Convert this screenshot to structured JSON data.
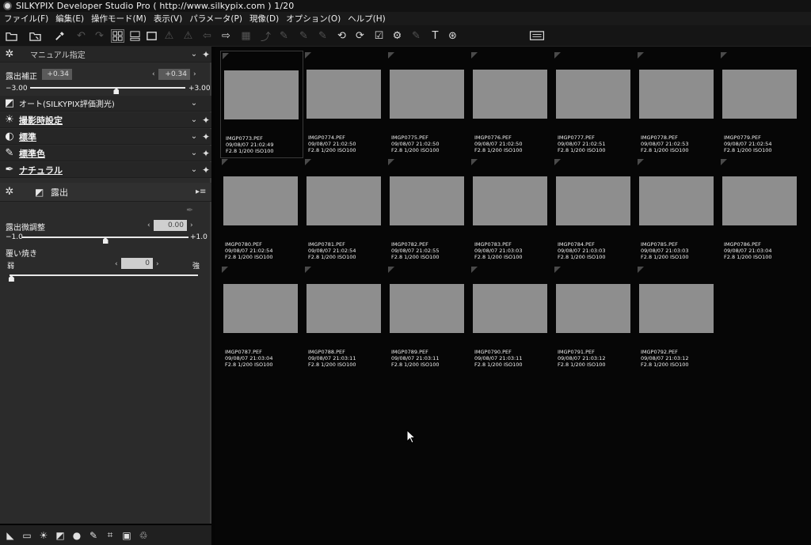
{
  "window": {
    "title": "SILKYPIX Developer Studio Pro ( http://www.silkypix.com ) 1/20"
  },
  "menu": [
    "ファイル(F)",
    "編集(E)",
    "操作モード(M)",
    "表示(V)",
    "パラメータ(P)",
    "現像(D)",
    "オプション(O)",
    "ヘルプ(H)"
  ],
  "toolbar": {
    "icons": [
      "open-folder-icon",
      "browse-folder-icon",
      "eyedropper-icon",
      "undo-icon",
      "redo-icon",
      "grid-view-icon",
      "filmstrip-view-icon",
      "single-view-icon",
      "warning-icon",
      "warning-icon-2",
      "back-icon",
      "forward-icon",
      "crop-icon",
      "rotate-left-icon",
      "rotate-right-icon",
      "checkbox-icon",
      "mark-icon",
      "pen-icon",
      "hammer-icon",
      "settings-icon",
      "monitor-icon"
    ]
  },
  "panel": {
    "mode_label": "マニュアル指定",
    "exposure_comp": {
      "label": "露出補正",
      "value": "+0.34",
      "value2": "+0.34",
      "min": "−3.00",
      "max": "+3.00",
      "level": 0.556
    },
    "auto_label": "オート(SILKYPIX評価測光)",
    "rows": [
      {
        "icon": "sun-icon",
        "label": "撮影時設定"
      },
      {
        "icon": "contrast-icon",
        "label": "標準"
      },
      {
        "icon": "color-icon",
        "label": "標準色"
      },
      {
        "icon": "palette-icon",
        "label": "ナチュラル"
      }
    ],
    "section_title": "露出",
    "fine_tune": {
      "label": "露出微調整",
      "value": "0.00",
      "min": "−1.0",
      "max": "+1.0",
      "level": 0.5
    },
    "dodge": {
      "label": "覆い焼き",
      "value": "0",
      "min": "弱",
      "max": "強",
      "level": 0.0
    }
  },
  "thumbnails": [
    {
      "file": "IMGP0773.PEF",
      "date": "09/08/07 21:02:49",
      "info": "F2.8 1/200 ISO100"
    },
    {
      "file": "IMGP0774.PEF",
      "date": "09/08/07 21:02:50",
      "info": "F2.8 1/200 ISO100"
    },
    {
      "file": "IMGP0775.PEF",
      "date": "09/08/07 21:02:50",
      "info": "F2.8 1/200 ISO100"
    },
    {
      "file": "IMGP0776.PEF",
      "date": "09/08/07 21:02:50",
      "info": "F2.8 1/200 ISO100"
    },
    {
      "file": "IMGP0777.PEF",
      "date": "09/08/07 21:02:51",
      "info": "F2.8 1/200 ISO100"
    },
    {
      "file": "IMGP0778.PEF",
      "date": "09/08/07 21:02:53",
      "info": "F2.8 1/200 ISO100"
    },
    {
      "file": "IMGP0779.PEF",
      "date": "09/08/07 21:02:54",
      "info": "F2.8 1/200 ISO100"
    },
    {
      "file": "IMGP0780.PEF",
      "date": "09/08/07 21:02:54",
      "info": "F2.8 1/200 ISO100"
    },
    {
      "file": "IMGP0781.PEF",
      "date": "09/08/07 21:02:54",
      "info": "F2.8 1/200 ISO100"
    },
    {
      "file": "IMGP0782.PEF",
      "date": "09/08/07 21:02:55",
      "info": "F2.8 1/200 ISO100"
    },
    {
      "file": "IMGP0783.PEF",
      "date": "09/08/07 21:03:03",
      "info": "F2.8 1/200 ISO100"
    },
    {
      "file": "IMGP0784.PEF",
      "date": "09/08/07 21:03:03",
      "info": "F2.8 1/200 ISO100"
    },
    {
      "file": "IMGP0785.PEF",
      "date": "09/08/07 21:03:03",
      "info": "F2.8 1/200 ISO100"
    },
    {
      "file": "IMGP0786.PEF",
      "date": "09/08/07 21:03:04",
      "info": "F2.8 1/200 ISO100"
    },
    {
      "file": "IMGP0787.PEF",
      "date": "09/08/07 21:03:04",
      "info": "F2.8 1/200 ISO100"
    },
    {
      "file": "IMGP0788.PEF",
      "date": "09/08/07 21:03:11",
      "info": "F2.8 1/200 ISO100"
    },
    {
      "file": "IMGP0789.PEF",
      "date": "09/08/07 21:03:11",
      "info": "F2.8 1/200 ISO100"
    },
    {
      "file": "IMGP0790.PEF",
      "date": "09/08/07 21:03:11",
      "info": "F2.8 1/200 ISO100"
    },
    {
      "file": "IMGP0791.PEF",
      "date": "09/08/07 21:03:12",
      "info": "F2.8 1/200 ISO100"
    },
    {
      "file": "IMGP0792.PEF",
      "date": "09/08/07 21:03:12",
      "info": "F2.8 1/200 ISO100"
    }
  ],
  "bottom_icons": [
    "comment-icon",
    "chat-icon",
    "sun-icon",
    "exposure-icon",
    "ball-icon",
    "tone-icon",
    "crop-icon",
    "lens-icon",
    "recycle-icon"
  ]
}
